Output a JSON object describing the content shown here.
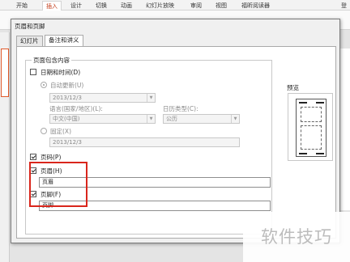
{
  "ribbon": {
    "tabs": [
      "开始",
      "插入",
      "设计",
      "切换",
      "动画",
      "幻灯片放映",
      "审阅",
      "视图",
      "福昕阅读器"
    ],
    "active_tab": "插入",
    "right_label": "登"
  },
  "dialog": {
    "title": "页眉和页脚",
    "tabs": [
      "幻灯片",
      "备注和讲义"
    ],
    "active_tab": "备注和讲义",
    "group_label": "页面包含内容",
    "date_time": {
      "label": "日期和时间(D)",
      "checked": false
    },
    "auto_update": {
      "label": "自动更新(U)",
      "selected": true,
      "enabled": false
    },
    "auto_date_value": "2013/12/3",
    "language": {
      "label": "语言(国家/地区)(L):",
      "value": "中文(中国)"
    },
    "calendar": {
      "label": "日历类型(C):",
      "value": "公历"
    },
    "fixed": {
      "label": "固定(X)",
      "selected": false,
      "enabled": false
    },
    "fixed_value": "2013/12/3",
    "page_number": {
      "label": "页码(P)",
      "checked": true
    },
    "header": {
      "label": "页眉(H)",
      "checked": true,
      "value": "页眉"
    },
    "footer": {
      "label": "页脚(F)",
      "checked": true,
      "value": "页脚"
    },
    "preview_label": "预览"
  },
  "highlight_color": "#d9261c",
  "watermark": "软件技巧"
}
